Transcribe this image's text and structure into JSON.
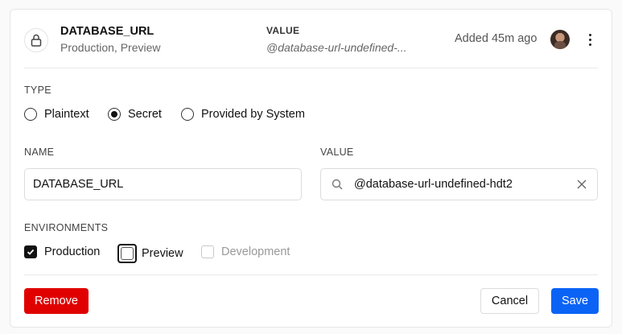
{
  "variable": {
    "name": "DATABASE_URL",
    "environments": "Production, Preview",
    "value_label": "VALUE",
    "value_preview": "@database-url-undefined-...",
    "added": "Added 45m ago"
  },
  "form": {
    "type_label": "TYPE",
    "type_options": [
      {
        "label": "Plaintext",
        "selected": false
      },
      {
        "label": "Secret",
        "selected": true
      },
      {
        "label": "Provided by System",
        "selected": false
      }
    ],
    "name_label": "NAME",
    "name_value": "DATABASE_URL",
    "value_label": "VALUE",
    "value_value": "@database-url-undefined-hdt2",
    "environments_label": "ENVIRONMENTS",
    "environment_options": [
      {
        "label": "Production",
        "checked": true,
        "disabled": false
      },
      {
        "label": "Preview",
        "checked": false,
        "disabled": false
      },
      {
        "label": "Development",
        "checked": false,
        "disabled": true
      }
    ]
  },
  "actions": {
    "remove": "Remove",
    "cancel": "Cancel",
    "save": "Save"
  },
  "colors": {
    "remove": "#e00000",
    "save": "#0b63f6"
  },
  "icons": [
    "lock-icon",
    "kebab-menu-icon",
    "search-icon",
    "clear-icon",
    "checkmark-icon"
  ]
}
